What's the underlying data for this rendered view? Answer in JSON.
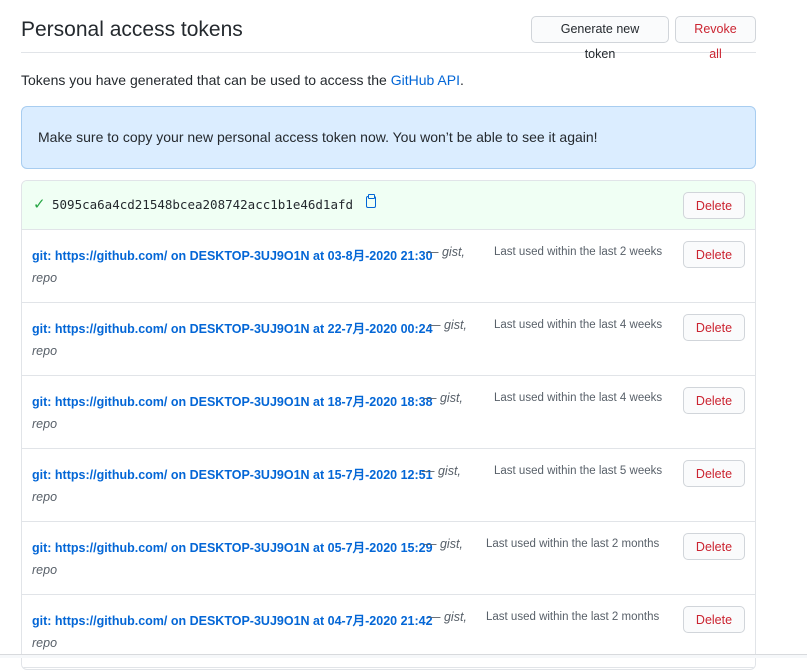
{
  "header": {
    "title": "Personal access tokens",
    "generate_label": "Generate new token",
    "revoke_label": "Revoke all"
  },
  "intro": {
    "text": "Tokens you have generated that can be used to access the ",
    "link": "GitHub API",
    "suffix": "."
  },
  "flash": {
    "message": "Make sure to copy your new personal access token now. You won’t be able to see it again!"
  },
  "new_token": {
    "check_icon": "check-icon",
    "value": "5095ca6a4cd21548bcea208742acc1b1e46d1afd",
    "copy_icon": "clipboard-icon",
    "delete_label": "Delete"
  },
  "tokens": [
    {
      "description": "git: https://github.com/ on DESKTOP-3UJ9O1N at 03-8月-2020 21:30",
      "scopes_line1": "— gist,",
      "scopes_line2": "repo",
      "last_used": "Last used within the last 2 weeks",
      "delete_label": "Delete"
    },
    {
      "description": "git: https://github.com/ on DESKTOP-3UJ9O1N at 22-7月-2020 00:24",
      "scopes_line1": "— gist,",
      "scopes_line2": "repo",
      "last_used": "Last used within the last 4 weeks",
      "delete_label": "Delete"
    },
    {
      "description": "git: https://github.com/ on DESKTOP-3UJ9O1N at 18-7月-2020 18:38",
      "scopes_line1": "— gist,",
      "scopes_line2": "repo",
      "last_used": "Last used within the last 4 weeks",
      "delete_label": "Delete"
    },
    {
      "description": "git: https://github.com/ on DESKTOP-3UJ9O1N at 15-7月-2020 12:51",
      "scopes_line1": "— gist,",
      "scopes_line2": "repo",
      "last_used": "Last used within the last 5 weeks",
      "delete_label": "Delete"
    },
    {
      "description": "git: https://github.com/ on DESKTOP-3UJ9O1N at 05-7月-2020 15:29",
      "scopes_line1": "— gist,",
      "scopes_line2": "repo",
      "last_used": "Last used within the last 2 months",
      "delete_label": "Delete"
    },
    {
      "description": "git: https://github.com/ on DESKTOP-3UJ9O1N at 04-7月-2020 21:42",
      "scopes_line1": "— gist,",
      "scopes_line2": "repo",
      "last_used": "Last used within the last 2 months",
      "delete_label": "Delete"
    }
  ],
  "colors": {
    "link": "#0366d6",
    "danger": "#cb2431",
    "success": "#28a745",
    "flash_bg": "#dbedff",
    "new_token_bg": "#f0fff4"
  }
}
